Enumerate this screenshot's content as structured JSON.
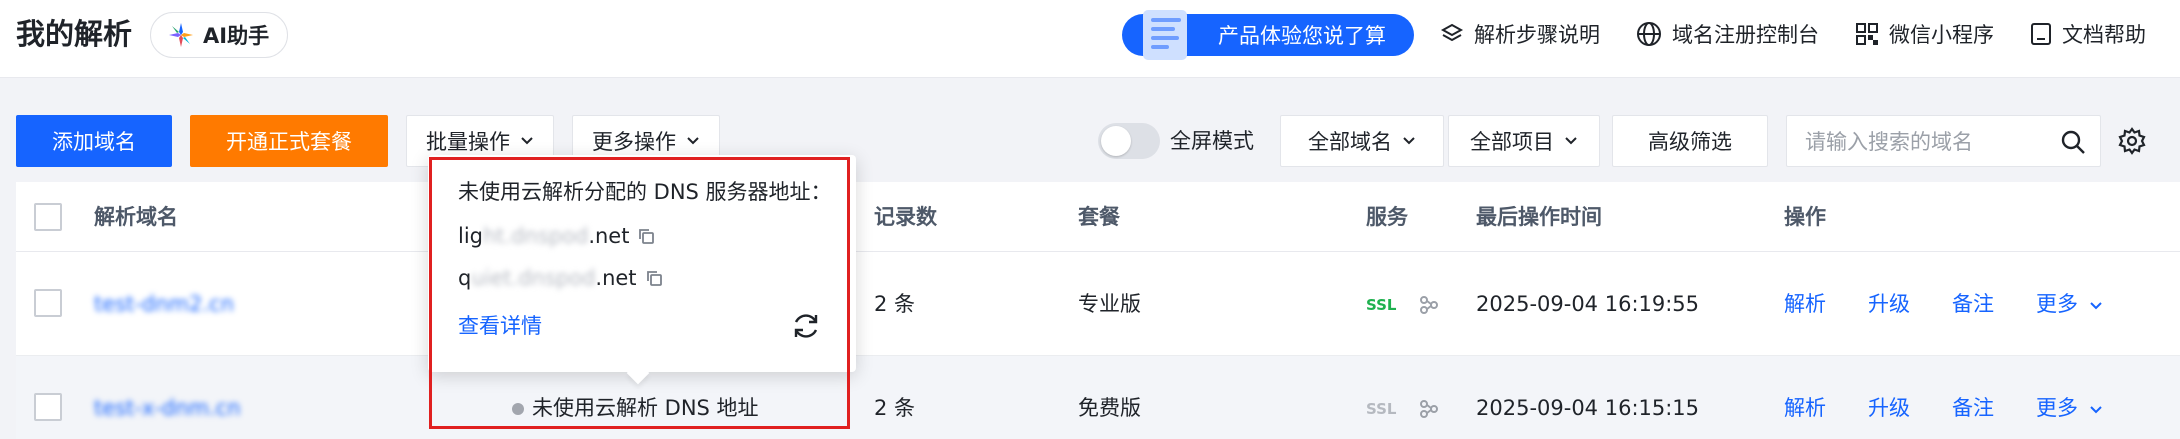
{
  "header": {
    "title": "我的解析",
    "ai_label": "AI助手",
    "experience_label": "产品体验您说了算",
    "links": [
      {
        "label": "解析步骤说明",
        "icon": "layers-icon"
      },
      {
        "label": "域名注册控制台",
        "icon": "globe-icon"
      },
      {
        "label": "微信小程序",
        "icon": "qrcode-icon"
      },
      {
        "label": "文档帮助",
        "icon": "document-icon"
      }
    ]
  },
  "toolbar": {
    "add_domain": "添加域名",
    "open_package": "开通正式套餐",
    "batch": "批量操作",
    "more_ops": "更多操作",
    "fullscreen": "全屏模式",
    "all_domains": "全部域名",
    "all_projects": "全部项目",
    "advanced_filter": "高级筛选",
    "search_placeholder": "请输入搜索的域名"
  },
  "table": {
    "headers": {
      "domain": "解析域名",
      "records": "记录数",
      "package": "套餐",
      "service": "服务",
      "last_time": "最后操作时间",
      "actions": "操作"
    },
    "rows": [
      {
        "domain": "test-dnm2.cn",
        "records": "2 条",
        "package": "专业版",
        "ssl": "SSL",
        "ssl_active": true,
        "time": "2025-09-04 16:19:55",
        "status": ""
      },
      {
        "domain": "test-x-dnm.cn",
        "records": "2 条",
        "package": "免费版",
        "ssl": "SSL",
        "ssl_active": false,
        "time": "2025-09-04 16:15:15",
        "status": "未使用云解析 DNS 地址"
      }
    ],
    "action_labels": {
      "resolve": "解析",
      "upgrade": "升级",
      "note": "备注",
      "more": "更多"
    }
  },
  "popover": {
    "title": "未使用云解析分配的 DNS 服务器地址：",
    "ns1_start": "lig",
    "ns1_mask": "ht.dnspod",
    "ns1_end": ".net",
    "ns2_start": "q",
    "ns2_mask": "uiet.dnspod",
    "ns2_end": ".net",
    "detail_link": "查看详情"
  },
  "colors": {
    "primary": "#1664ff",
    "orange": "#ff7a00",
    "ssl_green": "#1fb14f",
    "highlight": "#e02020"
  }
}
